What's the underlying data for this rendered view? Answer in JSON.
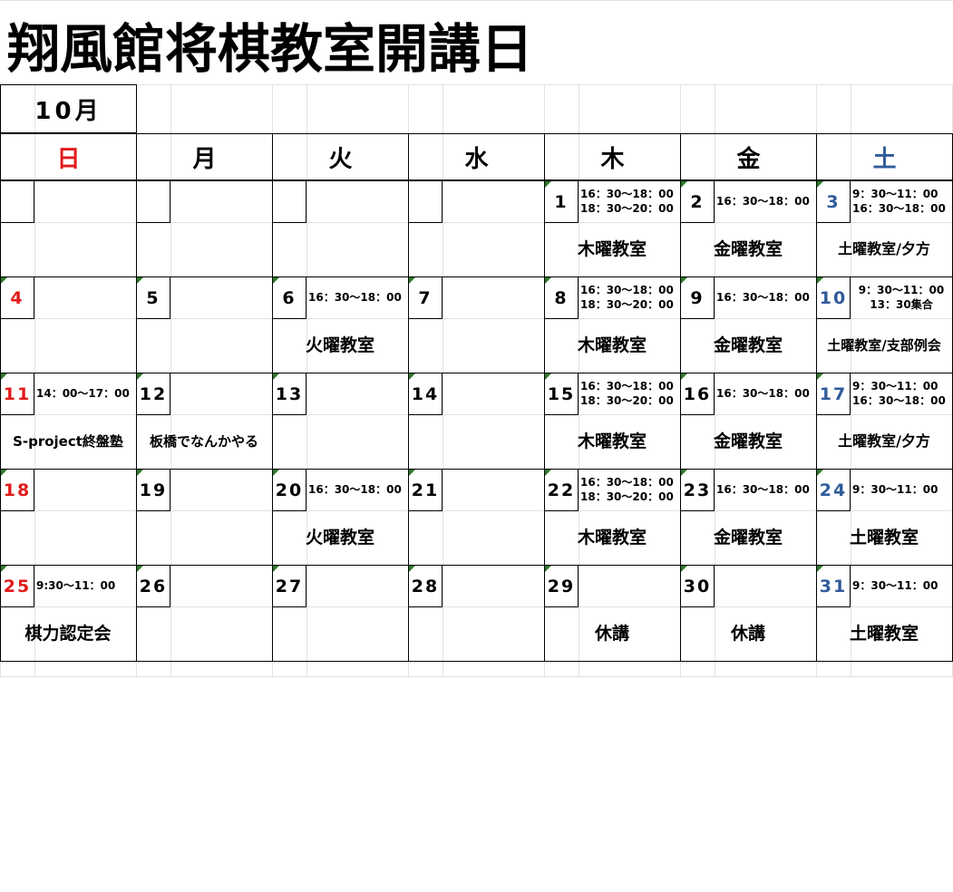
{
  "title": "翔風館将棋教室開講日",
  "month": "10月",
  "weekdays": [
    "日",
    "月",
    "火",
    "水",
    "木",
    "金",
    "土"
  ],
  "colors": {
    "sunday": "#e21a1a",
    "saturday": "#2f5b9a",
    "note_marker": "#2a7a2a"
  },
  "weeks": [
    [
      {
        "day": "",
        "times": [],
        "label": ""
      },
      {
        "day": "",
        "times": [],
        "label": ""
      },
      {
        "day": "",
        "times": [],
        "label": ""
      },
      {
        "day": "",
        "times": [],
        "label": ""
      },
      {
        "day": "1",
        "times": [
          "16：30～18：00",
          "18：30～20：00"
        ],
        "label": "木曜教室"
      },
      {
        "day": "2",
        "times": [
          "16：30～18：00"
        ],
        "label": "金曜教室"
      },
      {
        "day": "3",
        "times": [
          "9：30～11：00",
          "16：30～18：00"
        ],
        "label": "土曜教室/夕方"
      }
    ],
    [
      {
        "day": "4",
        "times": [],
        "label": ""
      },
      {
        "day": "5",
        "times": [],
        "label": ""
      },
      {
        "day": "6",
        "times": [
          "16：30～18：00"
        ],
        "label": "火曜教室"
      },
      {
        "day": "7",
        "times": [],
        "label": ""
      },
      {
        "day": "8",
        "times": [
          "16：30～18：00",
          "18：30～20：00"
        ],
        "label": "木曜教室"
      },
      {
        "day": "9",
        "times": [
          "16：30～18：00"
        ],
        "label": "金曜教室"
      },
      {
        "day": "10",
        "times": [
          "9：30～11：00",
          "13：30集合"
        ],
        "label": "土曜教室/支部例会"
      }
    ],
    [
      {
        "day": "11",
        "times": [
          "14：00～17：00"
        ],
        "label": "S-project終盤塾"
      },
      {
        "day": "12",
        "times": [],
        "label": "板橋でなんかやる"
      },
      {
        "day": "13",
        "times": [],
        "label": ""
      },
      {
        "day": "14",
        "times": [],
        "label": ""
      },
      {
        "day": "15",
        "times": [
          "16：30～18：00",
          "18：30～20：00"
        ],
        "label": "木曜教室"
      },
      {
        "day": "16",
        "times": [
          "16：30～18：00"
        ],
        "label": "金曜教室"
      },
      {
        "day": "17",
        "times": [
          "9：30～11：00",
          "16：30～18：00"
        ],
        "label": "土曜教室/夕方"
      }
    ],
    [
      {
        "day": "18",
        "times": [],
        "label": ""
      },
      {
        "day": "19",
        "times": [],
        "label": ""
      },
      {
        "day": "20",
        "times": [
          "16：30～18：00"
        ],
        "label": "火曜教室"
      },
      {
        "day": "21",
        "times": [],
        "label": ""
      },
      {
        "day": "22",
        "times": [
          "16：30～18：00",
          "18：30～20：00"
        ],
        "label": "木曜教室"
      },
      {
        "day": "23",
        "times": [
          "16：30～18：00"
        ],
        "label": "金曜教室"
      },
      {
        "day": "24",
        "times": [
          "9：30～11：00"
        ],
        "label": "土曜教室"
      }
    ],
    [
      {
        "day": "25",
        "times": [
          "9:30～11：00"
        ],
        "label": "棋力認定会"
      },
      {
        "day": "26",
        "times": [],
        "label": ""
      },
      {
        "day": "27",
        "times": [],
        "label": ""
      },
      {
        "day": "28",
        "times": [],
        "label": ""
      },
      {
        "day": "29",
        "times": [],
        "label": "休講"
      },
      {
        "day": "30",
        "times": [],
        "label": "休講"
      },
      {
        "day": "31",
        "times": [
          "9：30～11：00"
        ],
        "label": "土曜教室"
      }
    ]
  ]
}
